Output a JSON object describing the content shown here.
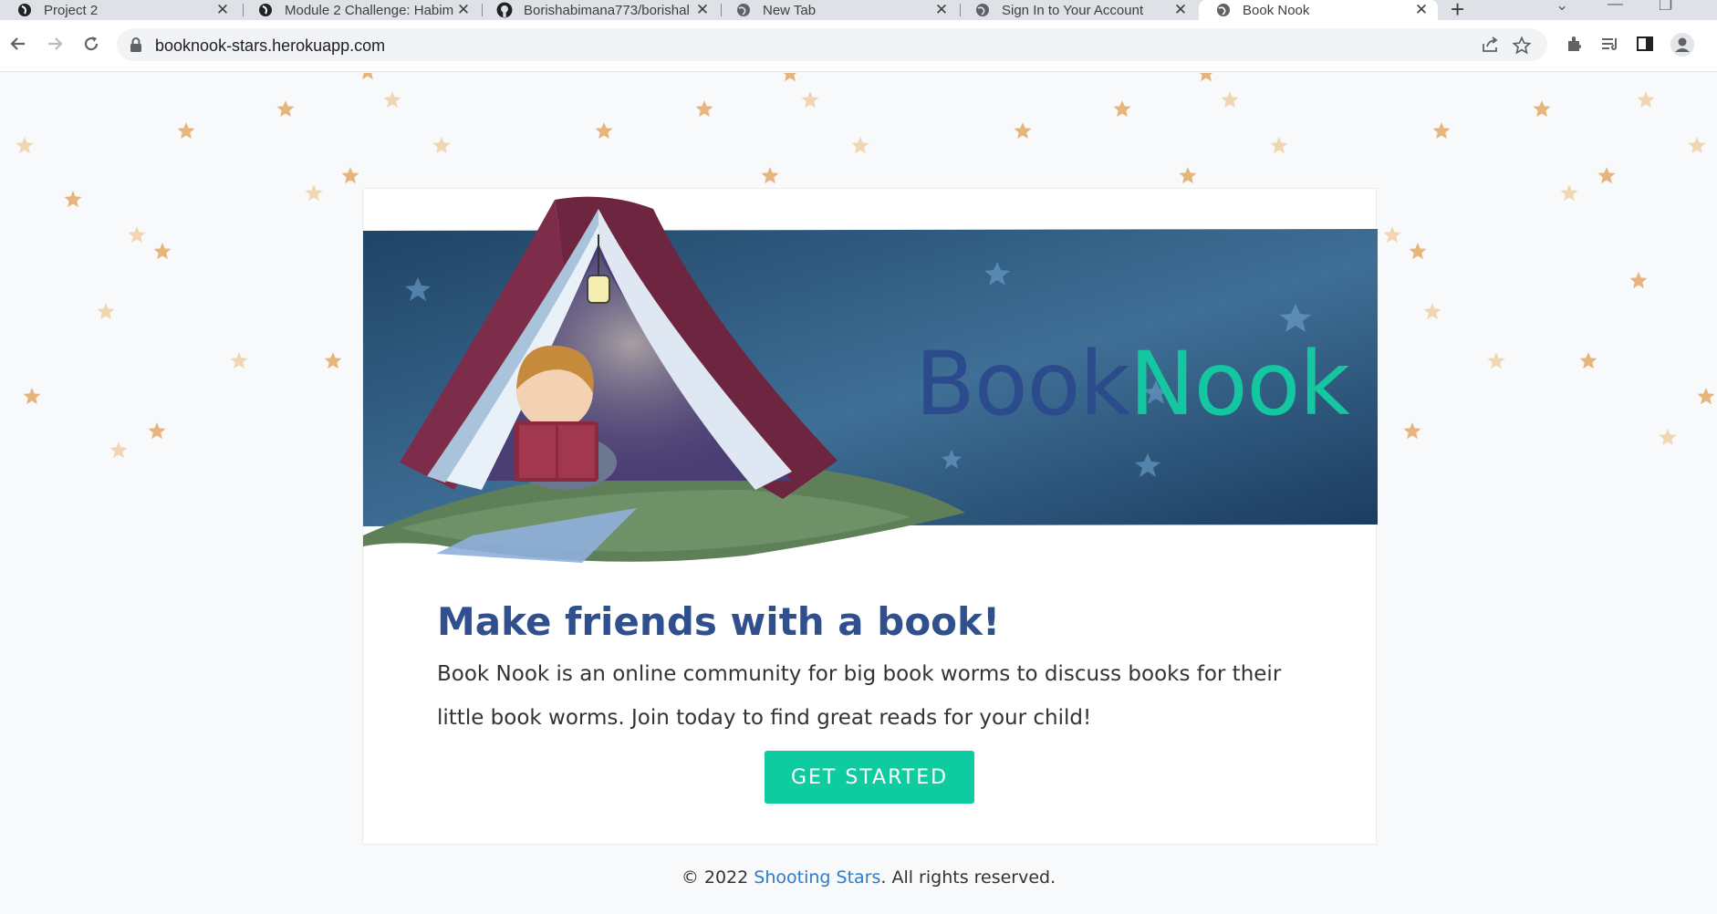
{
  "browser": {
    "tabs": [
      {
        "title": "Project 2",
        "icon": "figma-icon"
      },
      {
        "title": "Module 2 Challenge: Habim",
        "icon": "figma-icon"
      },
      {
        "title": "Borishabimana773/borishal",
        "icon": "github-icon"
      },
      {
        "title": "New Tab",
        "icon": "globe-icon"
      },
      {
        "title": "Sign In to Your Account",
        "icon": "globe-icon"
      },
      {
        "title": "Book Nook",
        "icon": "globe-icon",
        "active": true
      }
    ],
    "close_glyph": "✕",
    "new_tab_glyph": "+",
    "url": "booknook-stars.herokuapp.com"
  },
  "hero": {
    "brand_part1": "Book",
    "brand_part2": "Nook",
    "colors": {
      "night": "#2c5a82",
      "brand_blue": "#2b4b8c",
      "brand_green": "#15c7a0",
      "book_cover": "#8a2f4e"
    }
  },
  "main": {
    "headline": "Make friends with a book!",
    "description": "Book Nook is an online community for big book worms to discuss books for their little book worms. Join today to find great reads for your child!",
    "cta_label": "GET STARTED",
    "cta_color": "#0fcca0"
  },
  "footer": {
    "prefix": "© 2022 ",
    "link_text": "Shooting Stars",
    "suffix": ". All rights reserved."
  },
  "decor": {
    "star_color": "#e7b47c",
    "star_light_color": "#f1d6b4"
  }
}
